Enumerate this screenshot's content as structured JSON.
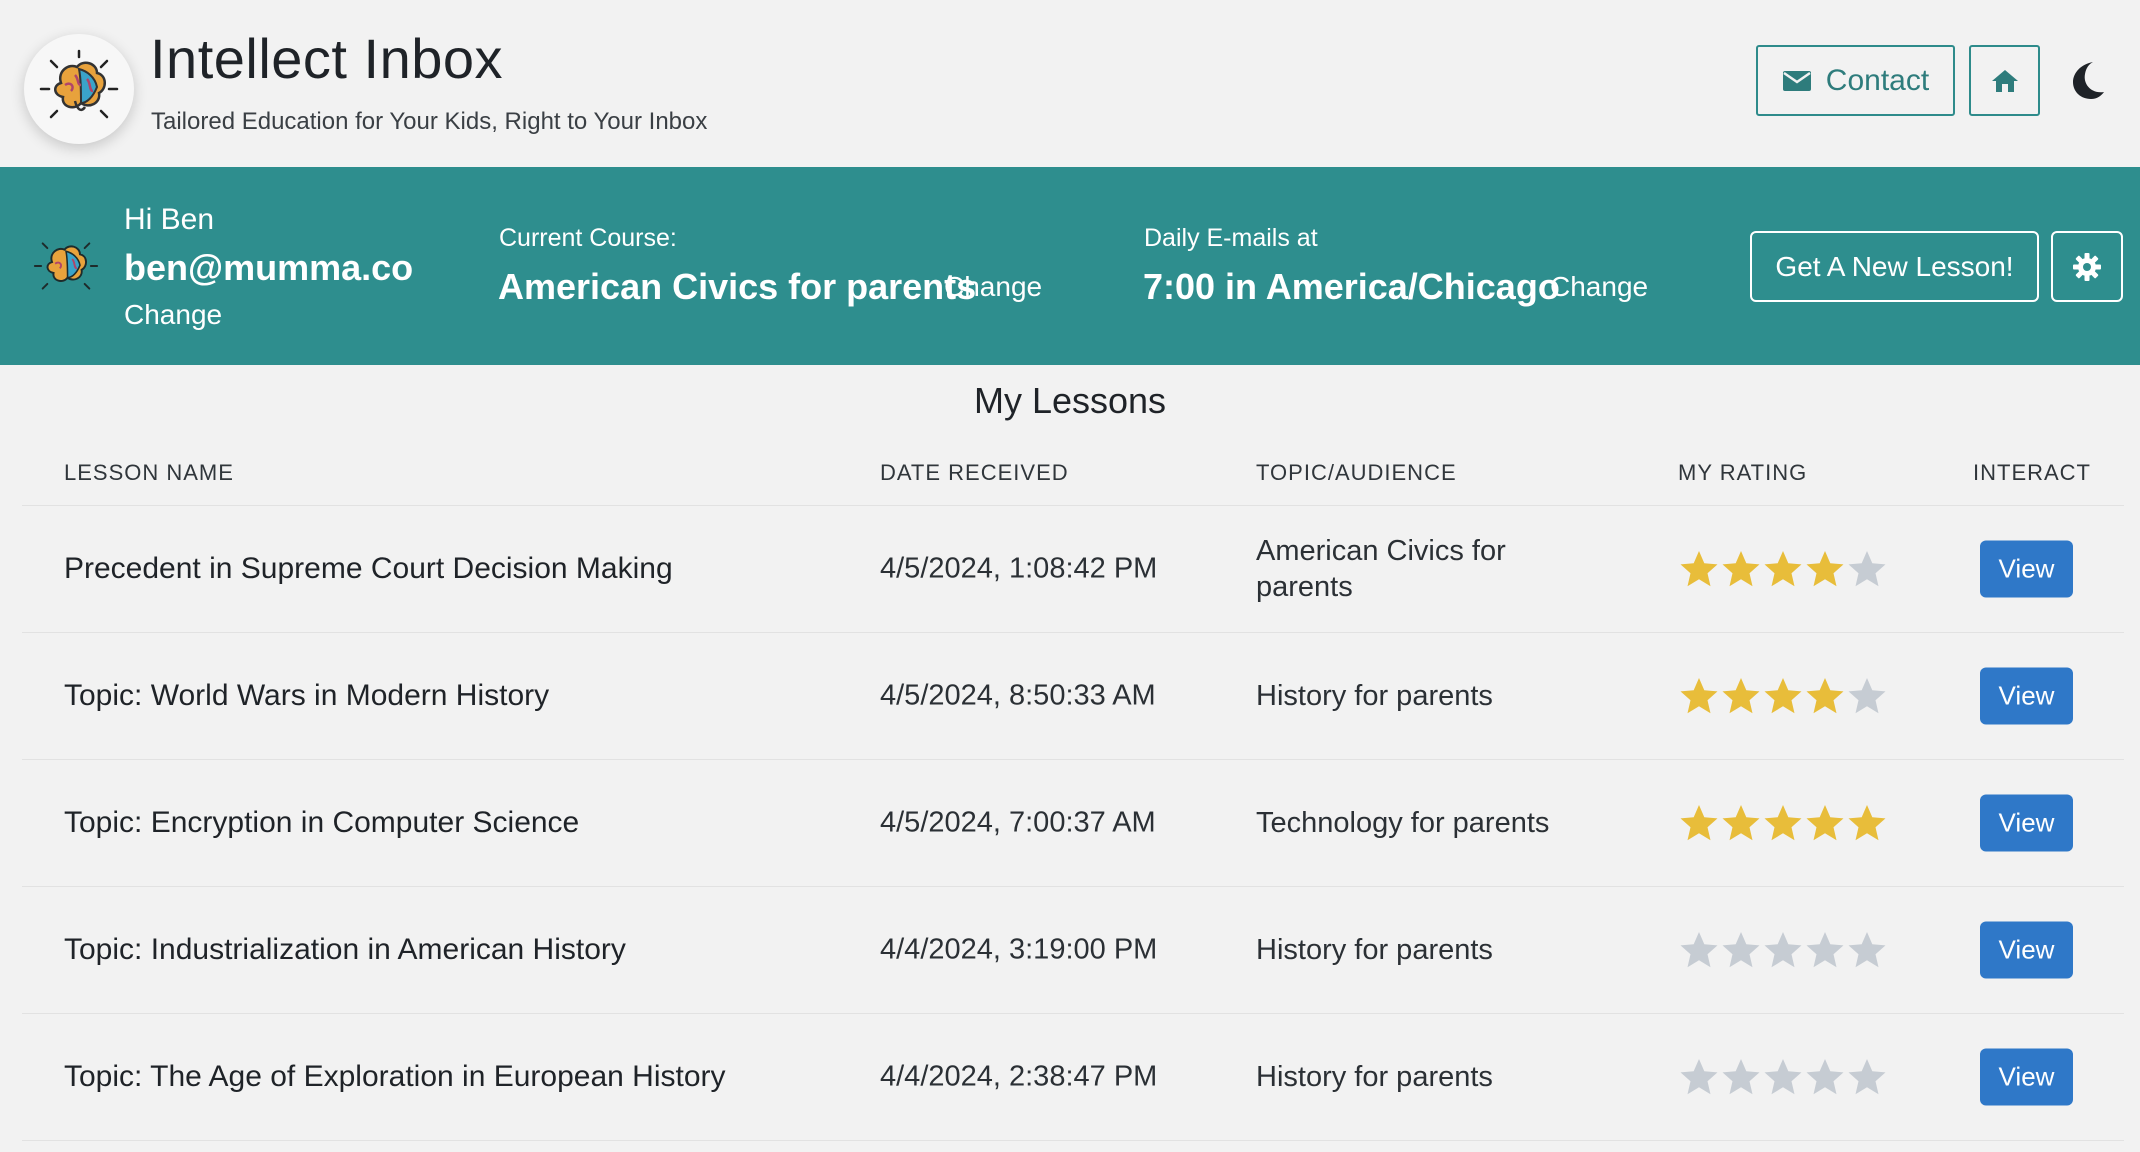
{
  "header": {
    "title": "Intellect Inbox",
    "subtitle": "Tailored Education for Your Kids, Right to Your Inbox",
    "contact_label": "Contact",
    "icons": [
      "brain-logo-icon",
      "envelope-icon",
      "home-icon",
      "moon-icon"
    ]
  },
  "banner": {
    "greeting": "Hi Ben",
    "email": "ben@mumma.co",
    "change_account": "Change",
    "course_label": "Current Course:",
    "course_value": "American Civics for parents",
    "course_change": "Change",
    "daily_label": "Daily E-mails at",
    "daily_value": "7:00 in America/Chicago",
    "daily_change": "Change",
    "new_lesson_label": "Get A New Lesson!",
    "icons": [
      "gear-icon"
    ]
  },
  "lessons": {
    "title": "My Lessons",
    "columns": [
      "LESSON NAME",
      "DATE RECEIVED",
      "TOPIC/AUDIENCE",
      "MY RATING",
      "INTERACT"
    ],
    "view_label": "View",
    "rows": [
      {
        "name": "Precedent in Supreme Court Decision Making",
        "date": "4/5/2024, 1:08:42 PM",
        "topic": "American Civics for parents",
        "rating": 4
      },
      {
        "name": "Topic: World Wars in Modern History",
        "date": "4/5/2024, 8:50:33 AM",
        "topic": "History for parents",
        "rating": 4
      },
      {
        "name": "Topic: Encryption in Computer Science",
        "date": "4/5/2024, 7:00:37 AM",
        "topic": "Technology for parents",
        "rating": 5
      },
      {
        "name": "Topic: Industrialization in American History",
        "date": "4/4/2024, 3:19:00 PM",
        "topic": "History for parents",
        "rating": 0
      },
      {
        "name": "Topic: The Age of Exploration in European History",
        "date": "4/4/2024, 2:38:47 PM",
        "topic": "History for parents",
        "rating": 0
      }
    ]
  },
  "colors": {
    "teal": "#2e8e8e",
    "star_filled": "#e8bd3a",
    "star_empty": "#c6ccd3",
    "view_button": "#2f78c8"
  }
}
